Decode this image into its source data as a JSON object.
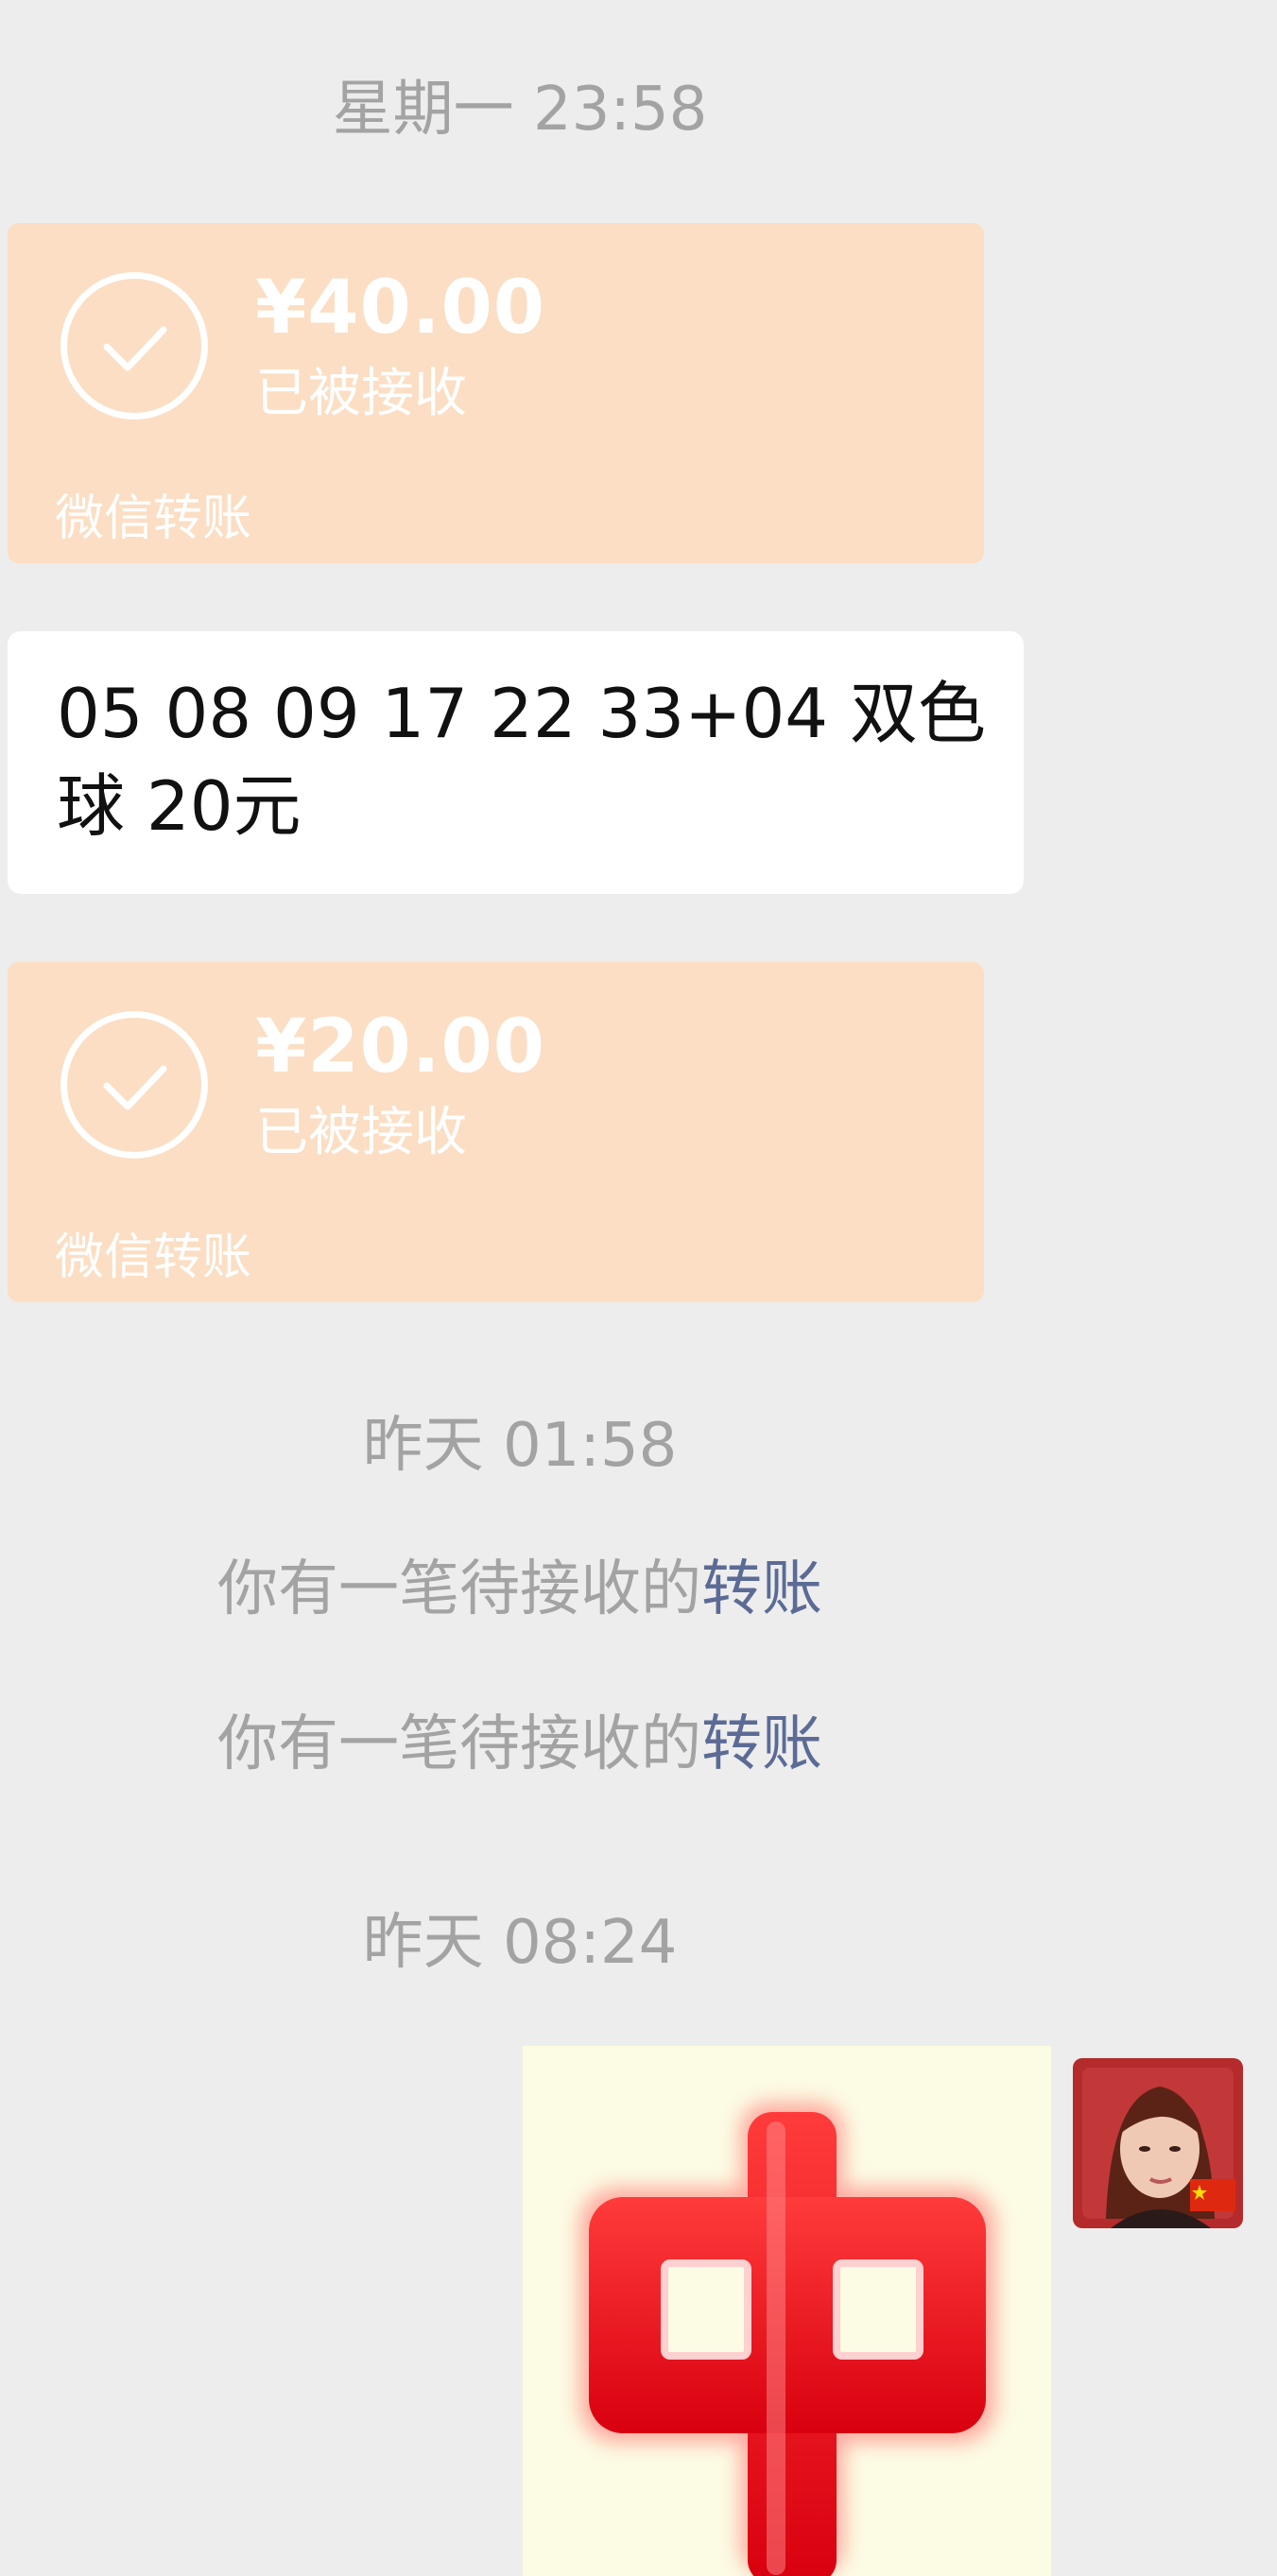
{
  "timestamps": {
    "first": "星期一 23:58",
    "second": "昨天 01:58",
    "third": "昨天 08:24"
  },
  "transfers": [
    {
      "amount": "¥40.00",
      "status": "已被接收",
      "source": "微信转账"
    },
    {
      "amount": "¥20.00",
      "status": "已被接收",
      "source": "微信转账"
    }
  ],
  "message": {
    "text": "05 08 09 17 22 33+04 双色球 20元"
  },
  "system_messages": [
    {
      "prefix": "你有一笔待接收的",
      "link": "转账"
    },
    {
      "prefix": "你有一笔待接收的",
      "link": "转账"
    }
  ],
  "colors": {
    "background": "#ededed",
    "transfer_card": "#fbdec3",
    "bubble": "#ffffff",
    "timestamp_text": "#a3a3a3",
    "link": "#5b6b95",
    "sticker_red": "#e8141c"
  },
  "icons": {
    "transfer_status": "check-circle-icon",
    "sticker": "zhong-sticker",
    "avatar_badge": "china-flag-icon"
  }
}
